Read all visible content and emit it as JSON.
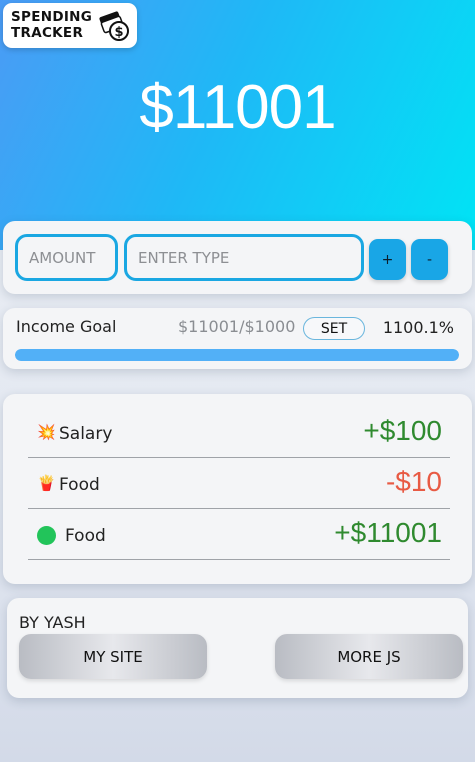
{
  "logo": {
    "line1": "SPENDING",
    "line2": "TRACKER"
  },
  "balance": "$11001",
  "entry": {
    "amount_placeholder": "AMOUNT",
    "type_placeholder": "ENTER TYPE",
    "add_label": "+",
    "subtract_label": "-"
  },
  "goal": {
    "label": "Income Goal",
    "progress_text": "$11001/$1000",
    "set_label": "SET",
    "percent_text": "1100.1%",
    "fill_fraction": 1.0
  },
  "transactions": [
    {
      "icon": "💥",
      "icon_name": "collision-icon",
      "label": "Salary",
      "amount": "+$100",
      "kind": "positive"
    },
    {
      "icon": "🍟",
      "icon_name": "fries-icon",
      "label": "Food",
      "amount": "-$10",
      "kind": "negative"
    },
    {
      "icon": "",
      "icon_name": "green-circle-icon",
      "label": "Food",
      "amount": "+$11001",
      "kind": "positive"
    }
  ],
  "footer": {
    "by_text": "BY YASH",
    "site_label": "MY SITE",
    "more_label": "MORE JS"
  },
  "colors": {
    "accent": "#1aa7e2",
    "positive": "#2f8a2f",
    "negative": "#e85a44",
    "progress": "#52b0f7"
  }
}
